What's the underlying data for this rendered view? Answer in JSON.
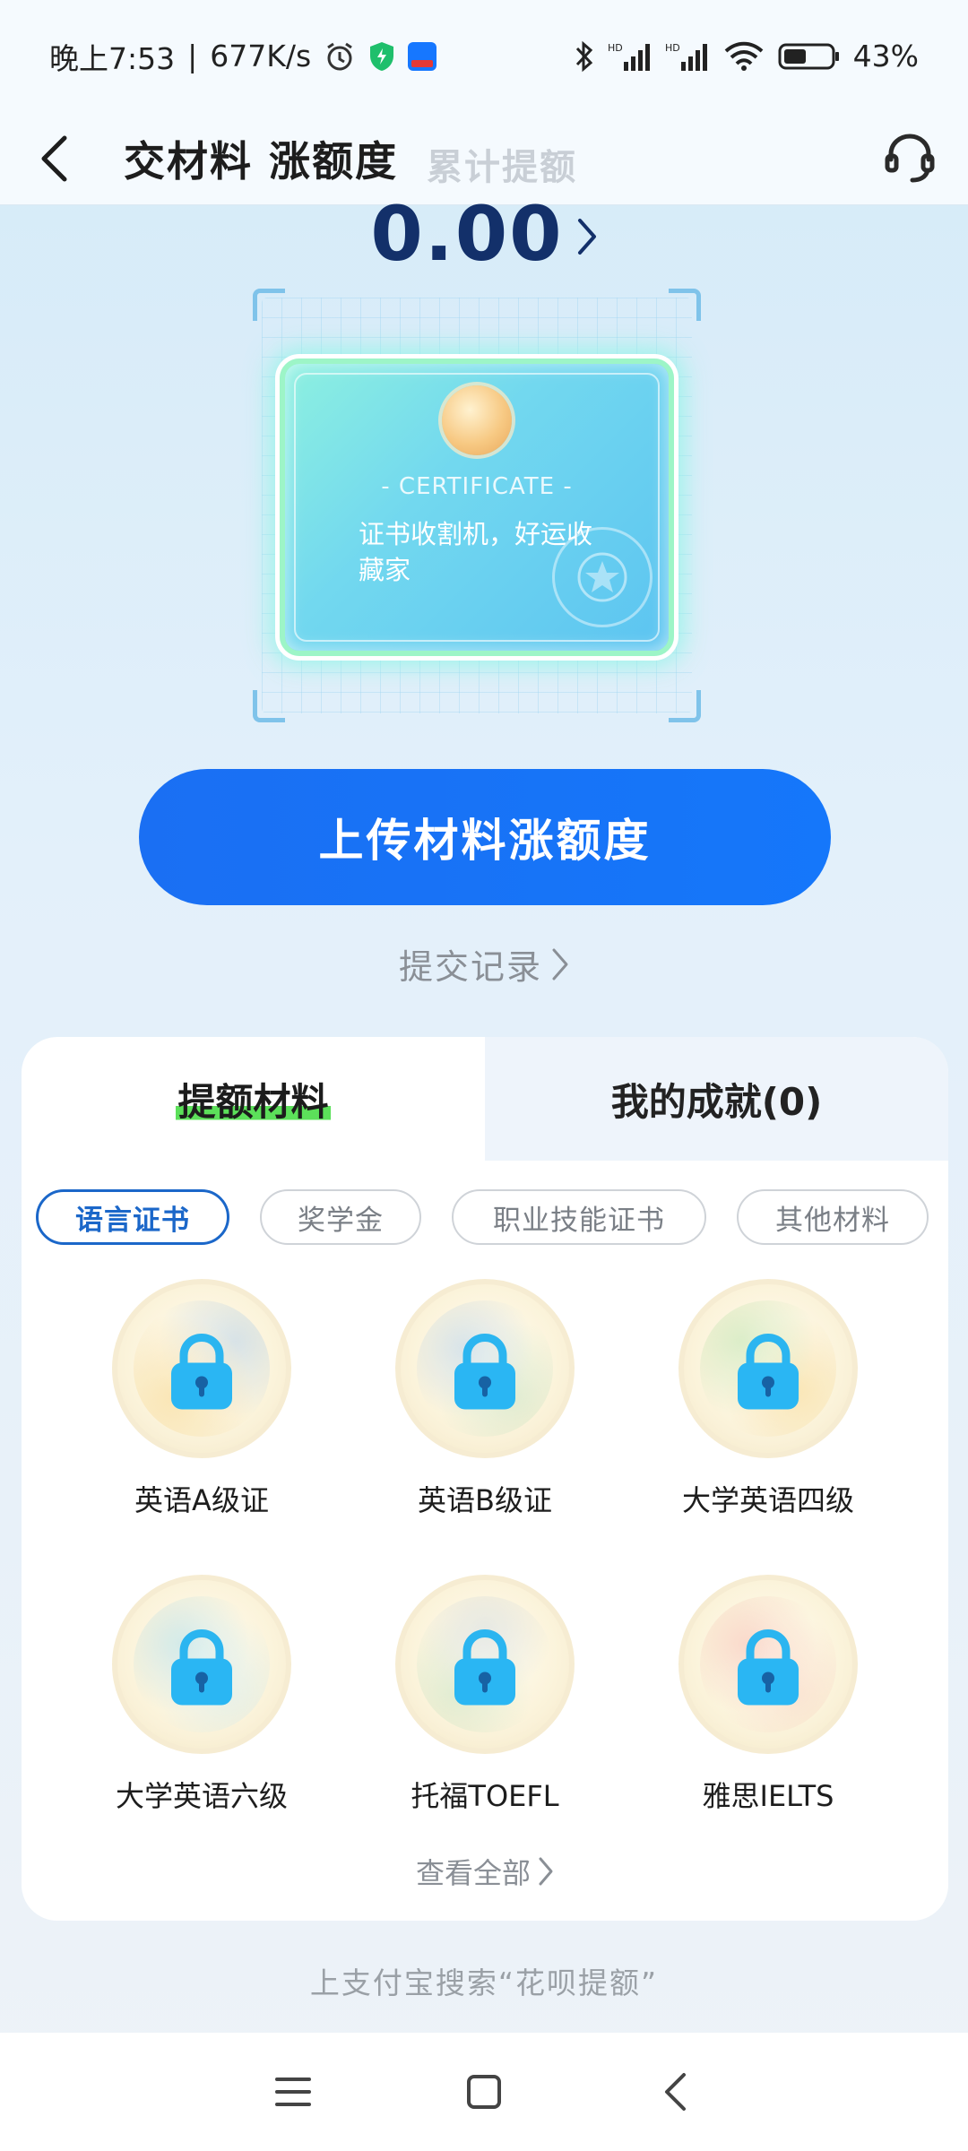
{
  "status_bar": {
    "time": "晚上7:53",
    "speed": "677K/s",
    "battery": "43%"
  },
  "header": {
    "title": "交材料 涨额度",
    "subtitle": "累计提额"
  },
  "amount": {
    "value": "0.00"
  },
  "certificate": {
    "label": "- CERTIFICATE -",
    "text": "证书收割机，好运收藏家"
  },
  "upload_button": "上传材料涨额度",
  "record_link": "提交记录",
  "tabs": [
    {
      "label": "提额材料",
      "active": true
    },
    {
      "label": "我的成就(0)",
      "active": false
    }
  ],
  "chips": [
    {
      "label": "语言证书",
      "selected": true
    },
    {
      "label": "奖学金",
      "selected": false
    },
    {
      "label": "职业技能证书",
      "selected": false
    },
    {
      "label": "其他材料",
      "selected": false
    }
  ],
  "badges": [
    {
      "label": "英语A级证",
      "deco": "#f5c35a"
    },
    {
      "label": "英语B级证",
      "deco": "#8fb8e8"
    },
    {
      "label": "大学英语四级",
      "deco": "#9ad88c"
    },
    {
      "label": "大学英语六级",
      "deco": "#7fcbe6"
    },
    {
      "label": "托福TOEFL",
      "deco": "#b9c7d8"
    },
    {
      "label": "雅思IELTS",
      "deco": "#f29a8e"
    }
  ],
  "view_all": "查看全部",
  "footer_hint": "上支付宝搜索“花呗提额”"
}
